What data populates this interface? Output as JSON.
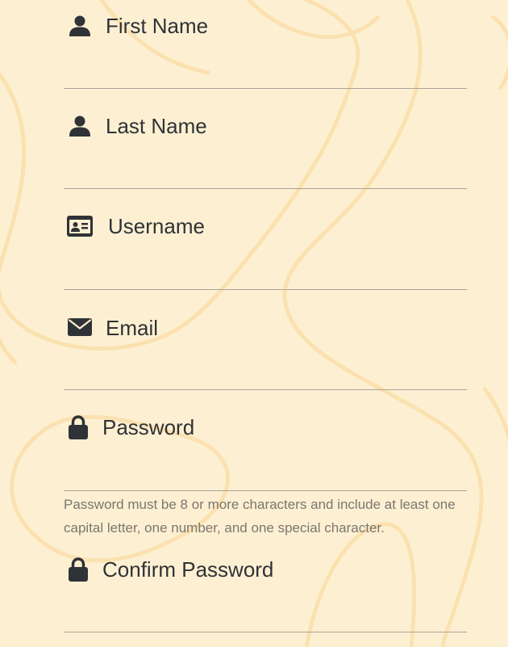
{
  "form": {
    "fields": [
      {
        "label": "First Name",
        "icon": "user-icon"
      },
      {
        "label": "Last Name",
        "icon": "user-icon"
      },
      {
        "label": "Username",
        "icon": "id-card-icon"
      },
      {
        "label": "Email",
        "icon": "envelope-icon"
      },
      {
        "label": "Password",
        "icon": "lock-icon"
      },
      {
        "label": "Confirm Password",
        "icon": "lock-icon"
      }
    ],
    "password_hint": "Password must be 8 or more characters and include at least one capital letter, one number, and one special character."
  },
  "colors": {
    "background": "#fdf0d2",
    "swirl": "#fbe1b0",
    "text": "#2f3237",
    "underline": "#a9a49a",
    "hint": "#7a7670"
  }
}
